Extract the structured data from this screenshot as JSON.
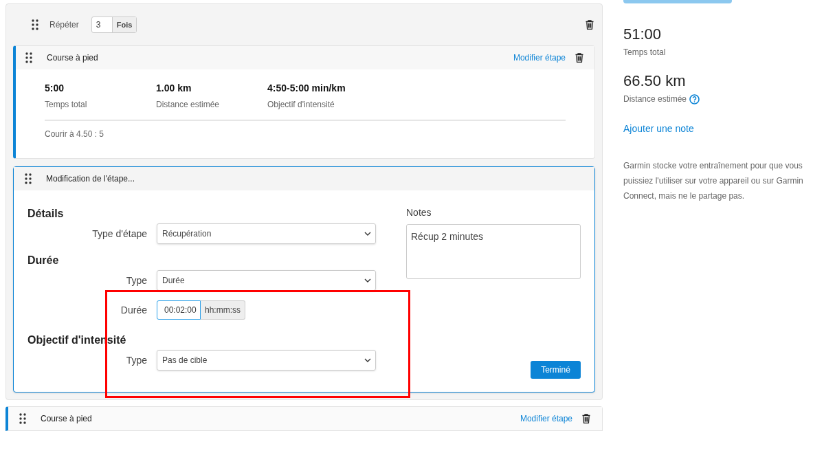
{
  "repeat": {
    "label": "Répéter",
    "count": "3",
    "unit": "Fois"
  },
  "steps": [
    {
      "kind": "summary",
      "title": "Course à pied",
      "edit_link": "Modifier étape",
      "stats": [
        {
          "value": "5:00",
          "label": "Temps total"
        },
        {
          "value": "1.00 km",
          "label": "Distance estimée"
        },
        {
          "value": "4:50-5:00 min/km",
          "label": "Objectif d'intensité"
        }
      ],
      "note": "Courir à 4.50 : 5"
    },
    {
      "kind": "editor",
      "title": "Modification de l'étape...",
      "sections": [
        {
          "heading": "Détails",
          "fields": [
            {
              "kind": "select",
              "label": "Type d'étape",
              "value": "Récupération"
            }
          ]
        },
        {
          "heading": "Durée",
          "fields": [
            {
              "kind": "select",
              "label": "Type",
              "value": "Durée"
            },
            {
              "kind": "time",
              "label": "Durée",
              "value": "00:02:00",
              "unit": "hh:mm:ss",
              "focused": true
            }
          ]
        },
        {
          "heading": "Objectif d'intensité",
          "fields": [
            {
              "kind": "select",
              "label": "Type",
              "value": "Pas de cible"
            }
          ]
        }
      ],
      "notes_label": "Notes",
      "notes_value": "Récup 2 minutes",
      "done_button": "Terminé"
    }
  ],
  "next_step": {
    "title": "Course à pied",
    "edit_link": "Modifier étape"
  },
  "summary": {
    "time": "51:00",
    "time_label": "Temps total",
    "distance": "66.50 km",
    "distance_label": "Distance estimée",
    "add_note": "Ajouter une note",
    "privacy_text": "Garmin stocke votre entraînement pour que vous puissiez l'utiliser sur votre appareil ou sur Garmin Connect, mais ne le partage pas."
  }
}
